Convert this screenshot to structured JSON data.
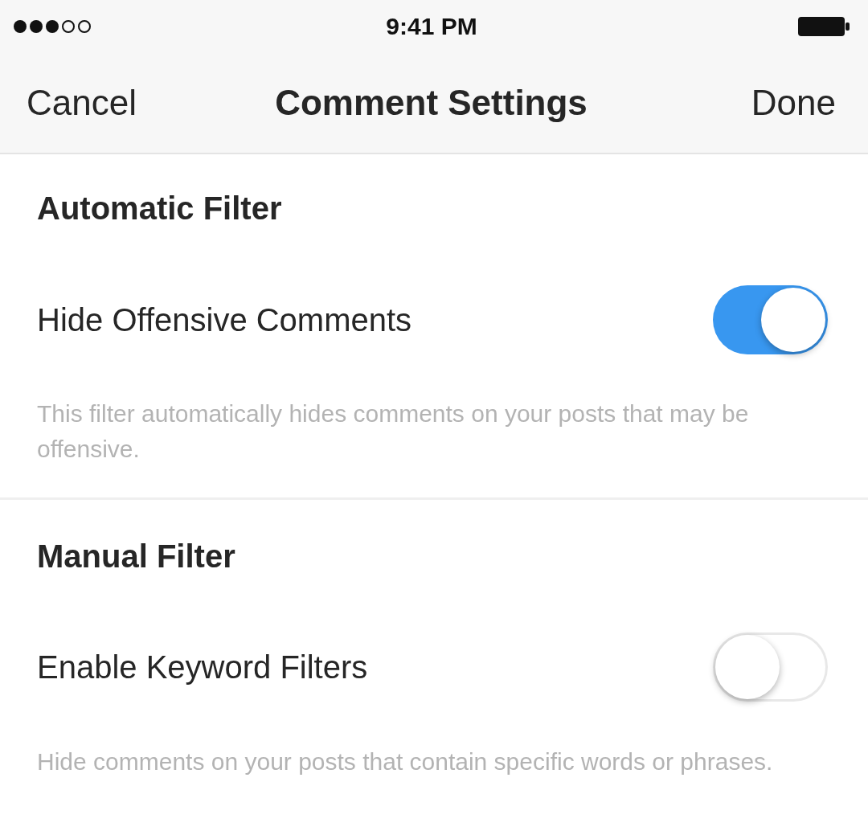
{
  "status_bar": {
    "time": "9:41 PM"
  },
  "nav_bar": {
    "left": "Cancel",
    "title": "Comment Settings",
    "right": "Done"
  },
  "sections": [
    {
      "title": "Automatic Filter",
      "setting": {
        "label": "Hide Offensive Comments",
        "on": true
      },
      "description": "This filter automatically hides comments on your posts that may be offensive."
    },
    {
      "title": "Manual Filter",
      "setting": {
        "label": "Enable Keyword Filters",
        "on": false
      },
      "description": "Hide comments on your posts that contain specific words or phrases."
    }
  ]
}
